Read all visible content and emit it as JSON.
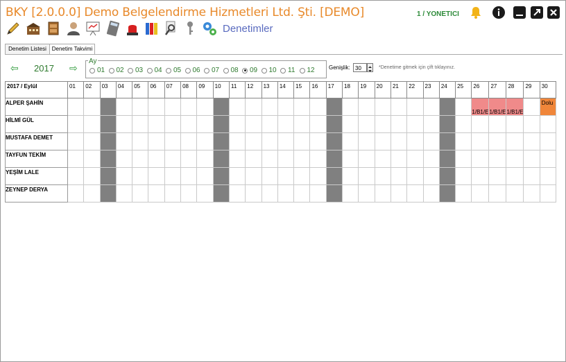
{
  "app": {
    "title": "BKY [2.0.0.0] Demo Belgelendirme Hizmetleri Ltd. Şti. [DEMO]",
    "user": "1 / YONETICI",
    "section": "Denetimler"
  },
  "window_buttons": [
    "bell-icon",
    "info-icon",
    "minimize-icon",
    "popout-icon",
    "close-icon"
  ],
  "toolbar": [
    "pencil-icon",
    "building-icon",
    "cabinet-icon",
    "user-icon",
    "presentation-icon",
    "calculator-icon",
    "alarm-light-icon",
    "binders-icon",
    "search-document-icon",
    "key-icon",
    "settings-gears-icon"
  ],
  "tabs": [
    {
      "label": "Denetim Listesi",
      "active": false
    },
    {
      "label": "Denetim Takvimi",
      "active": true
    }
  ],
  "nav": {
    "prev_icon": "left-arrow-icon",
    "next_icon": "right-arrow-icon",
    "year": "2017",
    "month_group_label": "Ay",
    "months": [
      "01",
      "02",
      "03",
      "04",
      "05",
      "06",
      "07",
      "08",
      "09",
      "10",
      "11",
      "12"
    ],
    "selected_month": "09",
    "width_label": "Genişlik:",
    "width_value": "30",
    "hint": "*Denetime gitmek için çift tıklayınız."
  },
  "calendar": {
    "corner": "2017 / Eylül",
    "days": [
      "01",
      "02",
      "03",
      "04",
      "05",
      "06",
      "07",
      "08",
      "09",
      "10",
      "11",
      "12",
      "13",
      "14",
      "15",
      "16",
      "17",
      "18",
      "19",
      "20",
      "21",
      "22",
      "23",
      "24",
      "25",
      "26",
      "27",
      "28",
      "29",
      "30"
    ],
    "weekend_days": [
      "03",
      "10",
      "17",
      "24"
    ],
    "auditors": [
      "ALPER ŞAHİN",
      "HİLMİ GÜL",
      "MUSTAFA DEMET",
      "TAYFUN TEKİM",
      "YEŞİM LALE",
      "ZEYNEP DERYA"
    ],
    "entries": [
      {
        "auditor": 0,
        "day": "26",
        "text": "1/B1/E",
        "status": "busy"
      },
      {
        "auditor": 0,
        "day": "27",
        "text": "1/B1/E",
        "status": "busy"
      },
      {
        "auditor": 0,
        "day": "28",
        "text": "1/B1/E",
        "status": "busy"
      },
      {
        "auditor": 0,
        "day": "30",
        "text": "Dolu",
        "status": "full"
      }
    ],
    "colors": {
      "weekend": "#808080",
      "busy": "#f08a8a",
      "full": "#f0863a"
    }
  }
}
